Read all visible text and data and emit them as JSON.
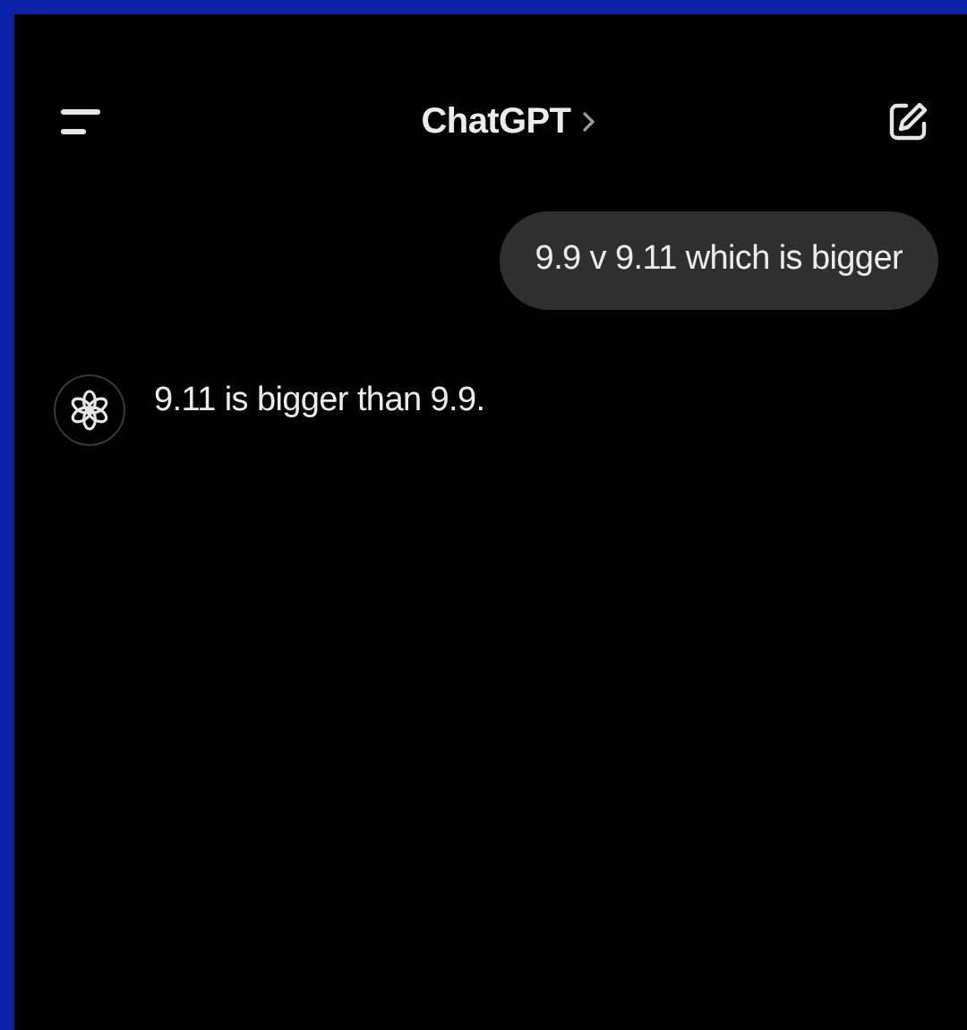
{
  "header": {
    "title": "ChatGPT"
  },
  "messages": [
    {
      "kind": "user",
      "text": "9.9 v 9.11 which is bigger"
    },
    {
      "kind": "assistant",
      "text": "9.11 is bigger than 9.9."
    }
  ]
}
